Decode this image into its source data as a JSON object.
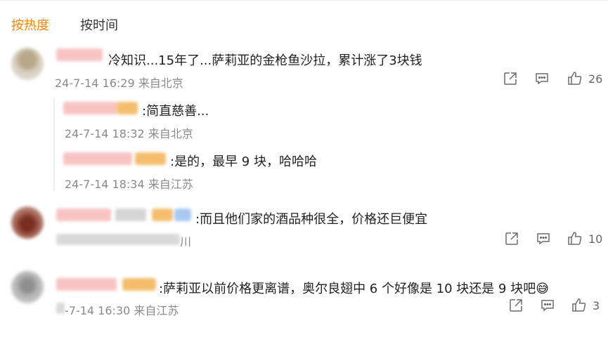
{
  "tabs": [
    {
      "label": "按热度",
      "active": true
    },
    {
      "label": "按时间",
      "active": false
    }
  ],
  "colors": {
    "accent": "#ff8200",
    "meta": "#8a8a8a",
    "text": "#222222"
  },
  "comments": [
    {
      "text": "冷知识...15年了...萨莉亚的金枪鱼沙拉，累计涨了3块钱",
      "meta": "24-7-14 16:29 来自北京",
      "likes": "26",
      "replies": [
        {
          "text": ":简直慈善...",
          "meta": "24-7-14 18:32 来自北京"
        },
        {
          "text": ":是的，最早 9 块，哈哈哈",
          "meta": "24-7-14 18:34 来自江苏"
        }
      ]
    },
    {
      "text": ":而且他们家的酒品种很全，价格还巨便宜",
      "meta": "川",
      "likes": "10"
    },
    {
      "text": ":萨莉亚以前价格更离谱，奥尔良翅中 6 个好像是 10 块还是 9 块吧",
      "emoji": "😅",
      "meta": "-7-14 16:30 来自江苏",
      "likes": "3"
    }
  ],
  "icons": {
    "share": "share-icon",
    "comment": "comment-icon",
    "like": "thumbs-up-icon"
  }
}
